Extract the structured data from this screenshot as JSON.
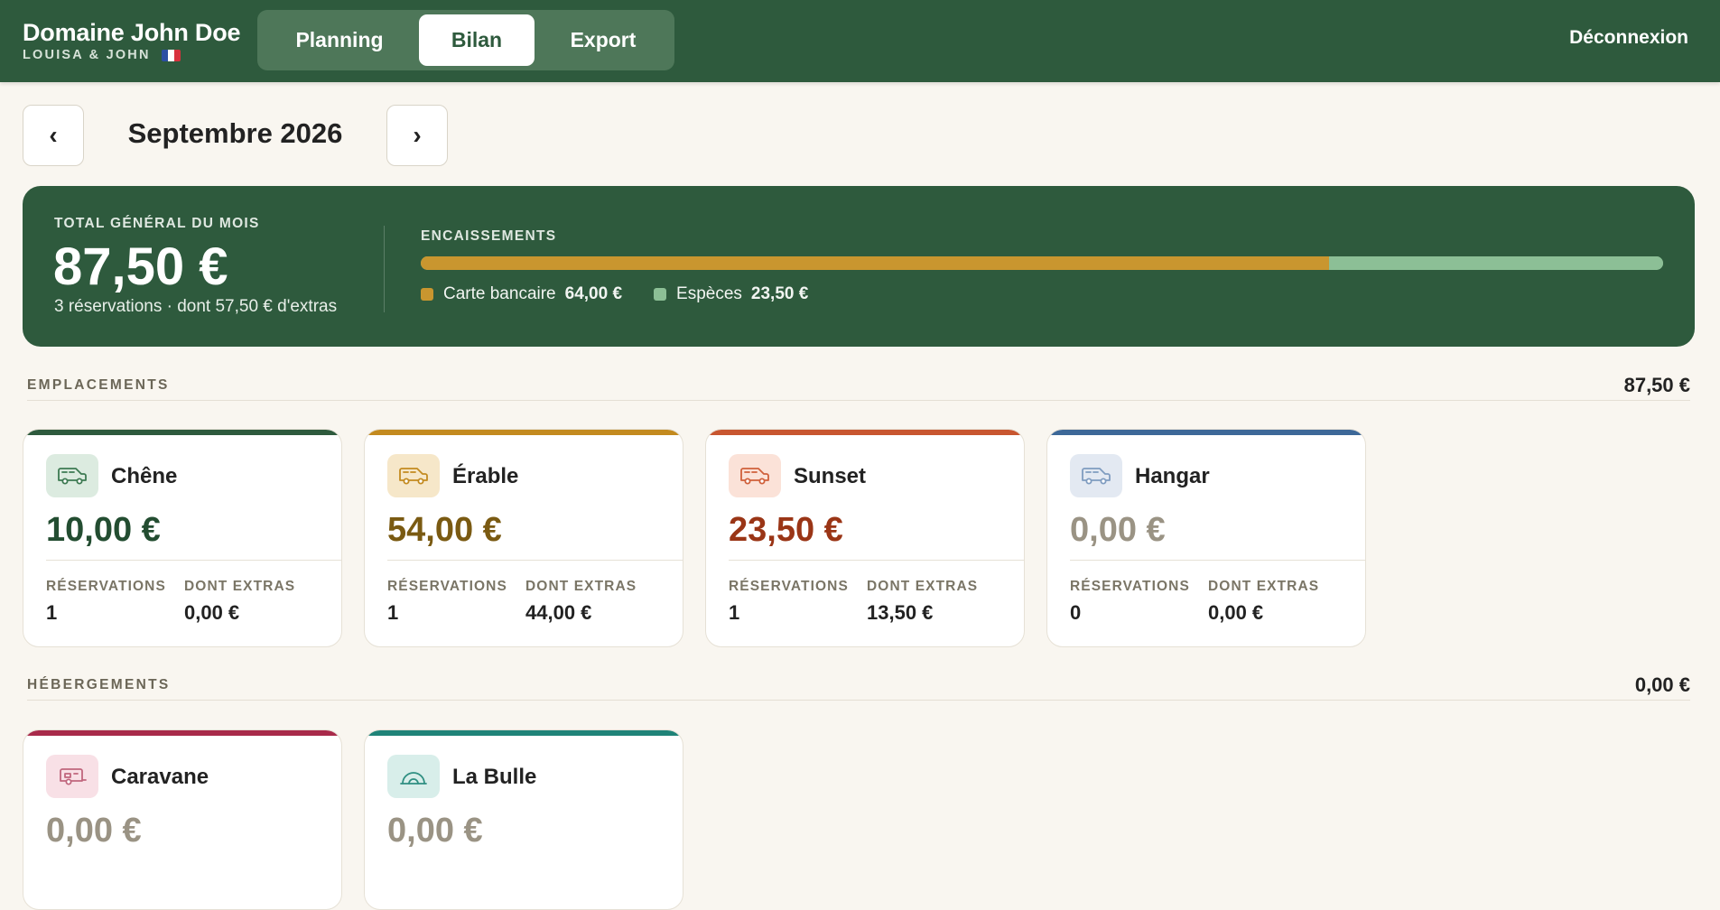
{
  "header": {
    "brand_title": "Domaine John Doe",
    "brand_subtitle": "LOUISA & JOHN",
    "flag_icon": "france-flag-icon",
    "nav_tabs": [
      {
        "label": "Planning",
        "active": false
      },
      {
        "label": "Bilan",
        "active": true
      },
      {
        "label": "Export",
        "active": false
      }
    ],
    "logout_label": "Déconnexion"
  },
  "month_nav": {
    "prev_label": "‹",
    "next_label": "›",
    "title": "Septembre 2026"
  },
  "summary": {
    "label": "TOTAL GÉNÉRAL DU MOIS",
    "amount": "87,50 €",
    "subtitle": "3 réservations · dont 57,50 € d'extras",
    "encaissements_label": "ENCAISSEMENTS",
    "payments": [
      {
        "label": "Carte bancaire",
        "value": "64,00 €",
        "amount": 64.0,
        "color": "#c9962f"
      },
      {
        "label": "Espèces",
        "value": "23,50 €",
        "amount": 23.5,
        "color": "#8cbf96"
      }
    ]
  },
  "emplacements": {
    "label": "EMPLACEMENTS",
    "total": "87,50 €",
    "cards": [
      {
        "name": "Chêne",
        "amount": "10,00 €",
        "reservations_label": "RÉSERVATIONS",
        "reservations": "1",
        "extras_label": "DONT EXTRAS",
        "extras": "0,00 €",
        "accent": "#2e5a3d",
        "amount_color": "#234d31",
        "icon": "camper-van-icon",
        "icon_color": "#3d7a52",
        "icon_bg": "#dcebe0"
      },
      {
        "name": "Érable",
        "amount": "54,00 €",
        "reservations_label": "RÉSERVATIONS",
        "reservations": "1",
        "extras_label": "DONT EXTRAS",
        "extras": "44,00 €",
        "accent": "#c38a1f",
        "amount_color": "#7a5a12",
        "icon": "camper-van-icon",
        "icon_color": "#c38a1f",
        "icon_bg": "#f6e7c9"
      },
      {
        "name": "Sunset",
        "amount": "23,50 €",
        "reservations_label": "RÉSERVATIONS",
        "reservations": "1",
        "extras_label": "DONT EXTRAS",
        "extras": "13,50 €",
        "accent": "#c85630",
        "amount_color": "#9a3516",
        "icon": "camper-van-icon",
        "icon_color": "#d0603b",
        "icon_bg": "#fbe2d8"
      },
      {
        "name": "Hangar",
        "amount": "0,00 €",
        "reservations_label": "RÉSERVATIONS",
        "reservations": "0",
        "extras_label": "DONT EXTRAS",
        "extras": "0,00 €",
        "accent": "#3d6898",
        "amount_color": "#9a9384",
        "icon": "camper-van-icon",
        "icon_color": "#7f9cc0",
        "icon_bg": "#e3e9f2"
      }
    ]
  },
  "hebergements": {
    "label": "HÉBERGEMENTS",
    "total": "0,00 €",
    "cards": [
      {
        "name": "Caravane",
        "amount": "0,00 €",
        "accent": "#a82a4a",
        "amount_color": "#9a9384",
        "icon": "caravan-icon",
        "icon_color": "#c0667e",
        "icon_bg": "#f8e0e6"
      },
      {
        "name": "La Bulle",
        "amount": "0,00 €",
        "accent": "#1f8378",
        "amount_color": "#9a9384",
        "icon": "bubble-tent-icon",
        "icon_color": "#2f8f82",
        "icon_bg": "#d8eeea"
      }
    ]
  }
}
